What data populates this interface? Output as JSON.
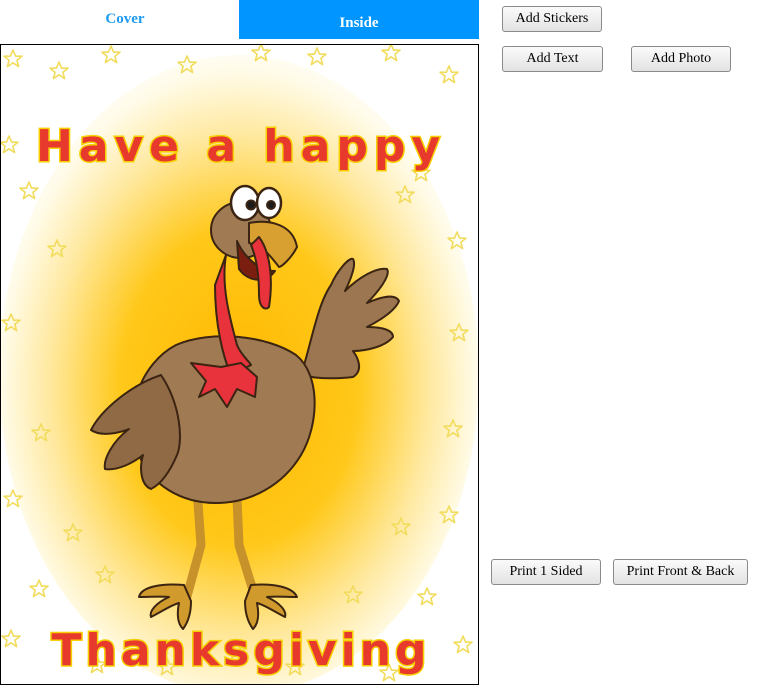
{
  "tabs": {
    "cover": "Cover",
    "inside": "Inside"
  },
  "toolbar": {
    "add_stickers": "Add Stickers",
    "add_text": "Add Text",
    "add_photo": "Add Photo"
  },
  "print": {
    "one_sided": "Print 1 Sided",
    "front_back": "Print Front & Back"
  },
  "card": {
    "line1": "Have a happy",
    "line2": "Thanksgiving",
    "illustration": "turkey-waving",
    "colors": {
      "glow": "#ffc200",
      "stars": "#f2dc5d",
      "lettering": "#e83a2c",
      "lettering_outline": "#f6d000",
      "turkey_body": "#a07a52",
      "wattle": "#e8323c"
    }
  }
}
